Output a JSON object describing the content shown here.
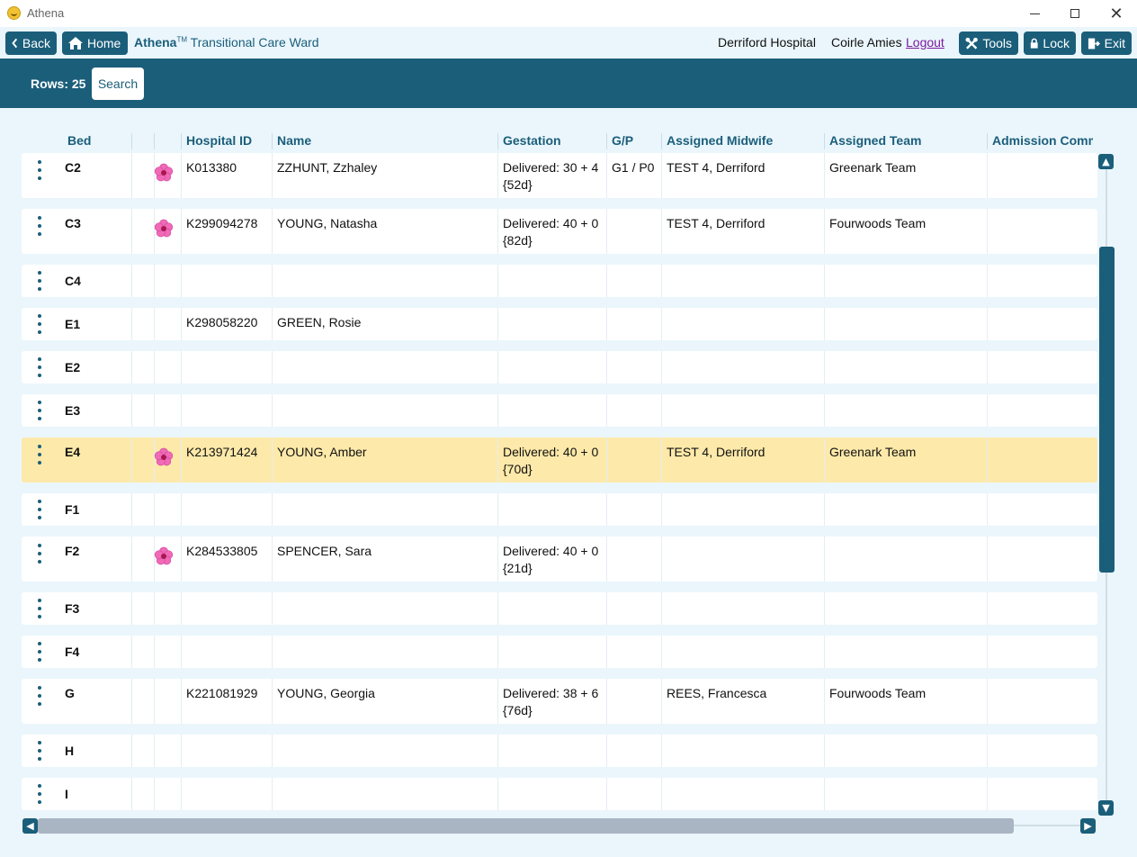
{
  "window": {
    "title": "Athena"
  },
  "nav": {
    "back_label": "Back",
    "home_label": "Home",
    "brand": "Athena",
    "tm": "TM",
    "ward": "Transitional Care Ward",
    "hospital": "Derriford Hospital",
    "user": "Coirle Amies",
    "logout": "Logout",
    "tools_label": "Tools",
    "lock_label": "Lock",
    "exit_label": "Exit"
  },
  "search": {
    "rows_label": "Rows: 25",
    "search_label": "Search"
  },
  "columns": [
    "Bed",
    "",
    "",
    "Hospital ID",
    "Name",
    "Gestation",
    "G/P",
    "Assigned Midwife",
    "Assigned Team",
    "Admission Comm"
  ],
  "rows": [
    {
      "bed": "C2",
      "flag": true,
      "hospital_id": "K013380",
      "name": "ZZHUNT, Zzhaley",
      "gestation": "Delivered: 30 + 4",
      "gestation_days": "{52d}",
      "gp": "G1 / P0",
      "midwife": "TEST 4, Derriford",
      "team": "Greenark Team"
    },
    {
      "bed": "C3",
      "flag": true,
      "hospital_id": "K299094278",
      "name": "YOUNG, Natasha",
      "gestation": "Delivered: 40 + 0",
      "gestation_days": "{82d}",
      "gp": "",
      "midwife": "TEST 4, Derriford",
      "team": "Fourwoods Team"
    },
    {
      "bed": "C4",
      "flag": false,
      "hospital_id": "",
      "name": "",
      "gestation": "",
      "gestation_days": "",
      "gp": "",
      "midwife": "",
      "team": ""
    },
    {
      "bed": "E1",
      "flag": false,
      "hospital_id": "K298058220",
      "name": "GREEN, Rosie",
      "gestation": "",
      "gestation_days": "",
      "gp": "",
      "midwife": "",
      "team": ""
    },
    {
      "bed": "E2",
      "flag": false,
      "hospital_id": "",
      "name": "",
      "gestation": "",
      "gestation_days": "",
      "gp": "",
      "midwife": "",
      "team": ""
    },
    {
      "bed": "E3",
      "flag": false,
      "hospital_id": "",
      "name": "",
      "gestation": "",
      "gestation_days": "",
      "gp": "",
      "midwife": "",
      "team": ""
    },
    {
      "bed": "E4",
      "flag": true,
      "selected": true,
      "hospital_id": "K213971424",
      "name": "YOUNG, Amber",
      "gestation": "Delivered: 40 + 0",
      "gestation_days": "{70d}",
      "gp": "",
      "midwife": "TEST 4, Derriford",
      "team": "Greenark Team"
    },
    {
      "bed": "F1",
      "flag": false,
      "hospital_id": "",
      "name": "",
      "gestation": "",
      "gestation_days": "",
      "gp": "",
      "midwife": "",
      "team": ""
    },
    {
      "bed": "F2",
      "flag": true,
      "hospital_id": "K284533805",
      "name": "SPENCER, Sara",
      "gestation": "Delivered: 40 + 0",
      "gestation_days": "{21d}",
      "gp": "",
      "midwife": "",
      "team": ""
    },
    {
      "bed": "F3",
      "flag": false,
      "hospital_id": "",
      "name": "",
      "gestation": "",
      "gestation_days": "",
      "gp": "",
      "midwife": "",
      "team": ""
    },
    {
      "bed": "F4",
      "flag": false,
      "hospital_id": "",
      "name": "",
      "gestation": "",
      "gestation_days": "",
      "gp": "",
      "midwife": "",
      "team": ""
    },
    {
      "bed": "G",
      "flag": false,
      "hospital_id": "K221081929",
      "name": "YOUNG, Georgia",
      "gestation": "Delivered: 38 + 6",
      "gestation_days": "{76d}",
      "gp": "",
      "midwife": "REES, Francesca",
      "team": "Fourwoods Team"
    },
    {
      "bed": "H",
      "flag": false,
      "hospital_id": "",
      "name": "",
      "gestation": "",
      "gestation_days": "",
      "gp": "",
      "midwife": "",
      "team": ""
    },
    {
      "bed": "I",
      "flag": false,
      "hospital_id": "",
      "name": "",
      "gestation": "",
      "gestation_days": "",
      "gp": "",
      "midwife": "",
      "team": ""
    }
  ],
  "icons": {
    "flag": "pink-flower-icon",
    "row_menu": "kebab-menu-icon"
  },
  "colors": {
    "accent": "#1b5e7a",
    "selected_row": "#fde9a9",
    "logout": "#7a1b9e"
  }
}
